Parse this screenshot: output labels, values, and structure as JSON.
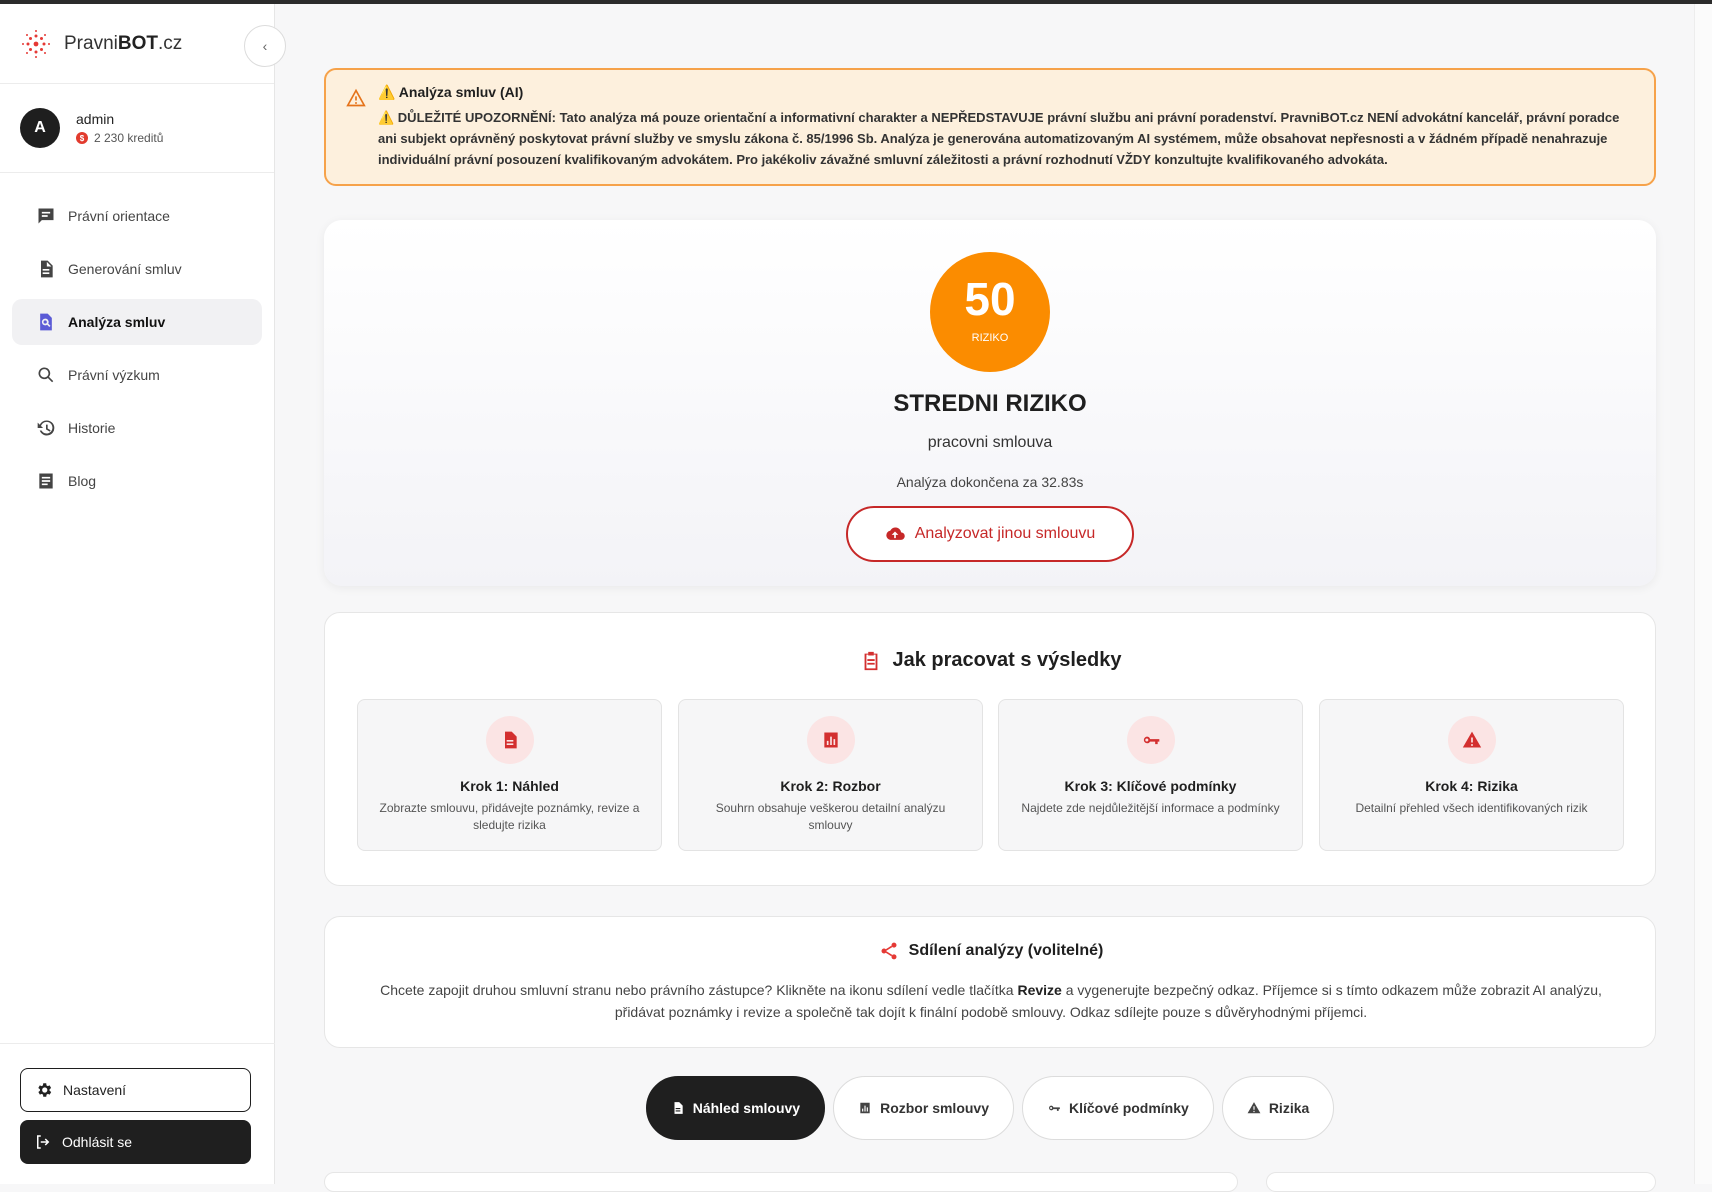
{
  "brand": {
    "name_part1": "Pravni",
    "name_part2": "BOT",
    "name_part3": ".cz"
  },
  "collapse_icon": "chevron-left",
  "user": {
    "avatar_letter": "A",
    "name": "admin",
    "credits": "2 230 kreditů"
  },
  "nav": {
    "items": [
      {
        "label": "Právní orientace",
        "icon": "chat-icon"
      },
      {
        "label": "Generování smluv",
        "icon": "document-icon"
      },
      {
        "label": "Analýza smluv",
        "icon": "document-search-icon",
        "active": true
      },
      {
        "label": "Právní výzkum",
        "icon": "search-icon"
      },
      {
        "label": "Historie",
        "icon": "history-icon"
      },
      {
        "label": "Blog",
        "icon": "article-icon"
      }
    ]
  },
  "sidebar_bottom": {
    "settings_label": "Nastavení",
    "logout_label": "Odhlásit se"
  },
  "warning": {
    "title": "⚠️ Analýza smluv (AI)",
    "text": "⚠️ DŮLEŽITÉ UPOZORNĚNÍ: Tato analýza má pouze orientační a informativní charakter a NEPŘEDSTAVUJE právní službu ani právní poradenství. PravniBOT.cz NENÍ advokátní kancelář, právní poradce ani subjekt oprávněný poskytovat právní služby ve smyslu zákona č. 85/1996 Sb. Analýza je generována automatizovaným AI systémem, může obsahovat nepřesnosti a v žádném případě nenahrazuje individuální právní posouzení kvalifikovaným advokátem. Pro jakékoliv závažné smluvní záležitosti a právní rozhodnutí VŽDY konzultujte kvalifikovaného advokáta."
  },
  "result": {
    "score": "50",
    "score_label": "RIZIKO",
    "level": "STREDNI RIZIKO",
    "contract_type": "pracovni smlouva",
    "done_text": "Analýza dokončena za 32.83s",
    "again_button": "Analyzovat jinou smlouvu",
    "score_color": "#fb8c00"
  },
  "how": {
    "title": "Jak pracovat s výsledky",
    "steps": [
      {
        "title": "Krok 1: Náhled",
        "desc": "Zobrazte smlouvu, přidávejte poznámky, revize a sledujte rizika",
        "icon": "document-icon"
      },
      {
        "title": "Krok 2: Rozbor",
        "desc": "Souhrn obsahuje veškerou detailní analýzu smlouvy",
        "icon": "chart-icon"
      },
      {
        "title": "Krok 3: Klíčové podmínky",
        "desc": "Najdete zde nejdůležitější informace a podmínky",
        "icon": "key-icon"
      },
      {
        "title": "Krok 4: Rizika",
        "desc": "Detailní přehled všech identifikovaných rizik",
        "icon": "warning-icon"
      }
    ]
  },
  "share": {
    "title": "Sdílení analýzy (volitelné)",
    "text_before": "Chcete zapojit druhou smluvní stranu nebo právního zástupce? Klikněte na ikonu sdílení vedle tlačítka ",
    "text_bold": "Revize",
    "text_after": " a vygenerujte bezpečný odkaz. Příjemce si s tímto odkazem může zobrazit AI analýzu, přidávat poznámky i revize a společně tak dojít k finální podobě smlouvy. Odkaz sdílejte pouze s důvěryhodnými příjemci."
  },
  "tabs": [
    {
      "label": "Náhled smlouvy",
      "active": true
    },
    {
      "label": "Rozbor smlouvy"
    },
    {
      "label": "Klíčové podmínky"
    },
    {
      "label": "Rizika"
    }
  ],
  "colors": {
    "accent_red": "#c62828",
    "warning_bg": "#fdf0dd",
    "warning_border": "#f6a24a",
    "dark": "#1f1f1f"
  }
}
